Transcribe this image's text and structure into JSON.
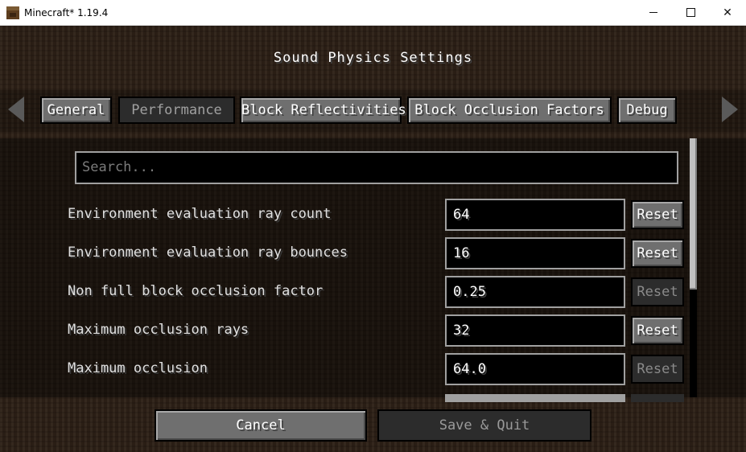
{
  "window": {
    "title": "Minecraft* 1.19.4",
    "controls": [
      "minimize",
      "maximize",
      "close"
    ],
    "close_glyph": "✕"
  },
  "screen": {
    "title": "Sound Physics Settings"
  },
  "tabs": [
    {
      "label": "General",
      "enabled": true
    },
    {
      "label": "Performance",
      "enabled": false
    },
    {
      "label": "Block Reflectivities",
      "enabled": true
    },
    {
      "label": "Block Occlusion Factors",
      "enabled": true
    },
    {
      "label": "Debug",
      "enabled": true
    }
  ],
  "search": {
    "placeholder": "Search..."
  },
  "rows": [
    {
      "label": "Environment evaluation ray count",
      "value": "64",
      "reset": "Reset",
      "reset_enabled": true
    },
    {
      "label": "Environment evaluation ray bounces",
      "value": "16",
      "reset": "Reset",
      "reset_enabled": true
    },
    {
      "label": "Non full block occlusion factor",
      "value": "0.25",
      "reset": "Reset",
      "reset_enabled": false
    },
    {
      "label": "Maximum occlusion rays",
      "value": "32",
      "reset": "Reset",
      "reset_enabled": true
    },
    {
      "label": "Maximum occlusion",
      "value": "64.0",
      "reset": "Reset",
      "reset_enabled": false
    }
  ],
  "footer": {
    "cancel": "Cancel",
    "save": "Save & Quit"
  },
  "icons": {
    "app": "minecraft-block-icon",
    "left": "arrow-left-icon",
    "right": "arrow-right-icon"
  }
}
